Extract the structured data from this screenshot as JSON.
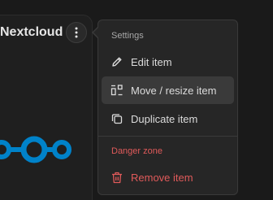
{
  "widget": {
    "title": "Nextcloud",
    "menu_icon": "kebab-icon",
    "logo": "nextcloud-logo",
    "logo_color": "#0082c9"
  },
  "menu": {
    "settings_label": "Settings",
    "items": [
      {
        "label": "Edit item",
        "icon": "pencil-icon"
      },
      {
        "label": "Move / resize item",
        "icon": "move-resize-icon"
      },
      {
        "label": "Duplicate item",
        "icon": "duplicate-icon"
      }
    ],
    "danger_label": "Danger zone",
    "danger_items": [
      {
        "label": "Remove item",
        "icon": "trash-icon"
      }
    ],
    "danger_color": "#e05a5a"
  }
}
